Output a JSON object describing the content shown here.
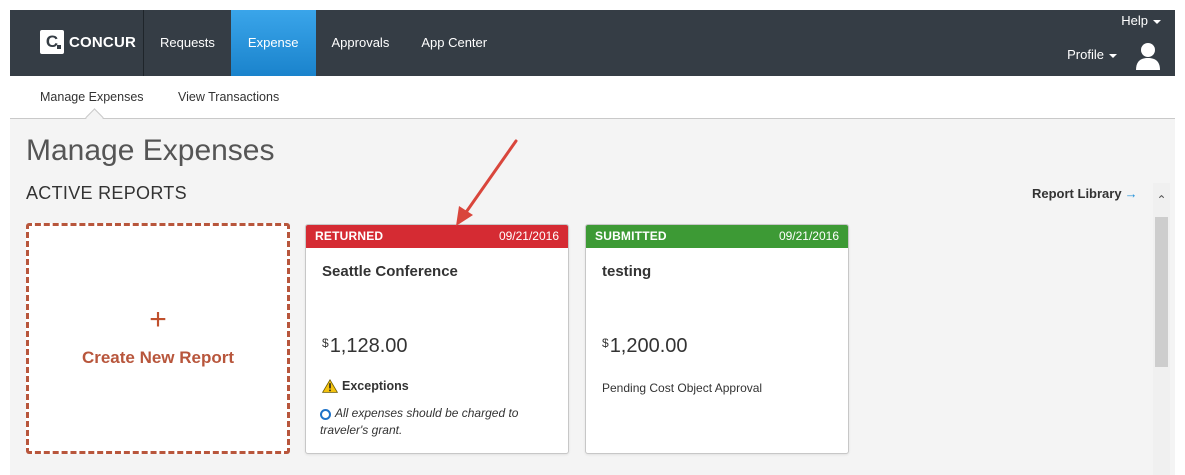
{
  "header": {
    "logo_mark": "C",
    "logo_text": "CONCUR",
    "nav": [
      {
        "label": "Requests",
        "active": false
      },
      {
        "label": "Expense",
        "active": true
      },
      {
        "label": "Approvals",
        "active": false
      },
      {
        "label": "App Center",
        "active": false
      }
    ],
    "help_label": "Help",
    "profile_label": "Profile"
  },
  "subnav": {
    "items": [
      {
        "label": "Manage Expenses",
        "active": true
      },
      {
        "label": "View Transactions",
        "active": false
      }
    ]
  },
  "main": {
    "page_title": "Manage Expenses",
    "section_title": "ACTIVE REPORTS",
    "report_library_label": "Report Library",
    "create_card": {
      "plus": "+",
      "label": "Create New Report"
    },
    "reports": [
      {
        "status": "RETURNED",
        "date": "09/21/2016",
        "name": "Seattle Conference",
        "currency_symbol": "$",
        "amount": "1,128.00",
        "exceptions_label": "Exceptions",
        "exception_message": "All expenses should be charged to traveler's grant.",
        "status_text": "",
        "header_color": "#d52b33"
      },
      {
        "status": "SUBMITTED",
        "date": "09/21/2016",
        "name": "testing",
        "currency_symbol": "$",
        "amount": "1,200.00",
        "exceptions_label": "",
        "exception_message": "",
        "status_text": "Pending Cost Object Approval",
        "header_color": "#3d9a35"
      }
    ]
  },
  "colors": {
    "topbar": "#353d45",
    "nav_active": "#1e90d9",
    "create_accent": "#b8563c",
    "annotation_arrow": "#d9463c"
  }
}
